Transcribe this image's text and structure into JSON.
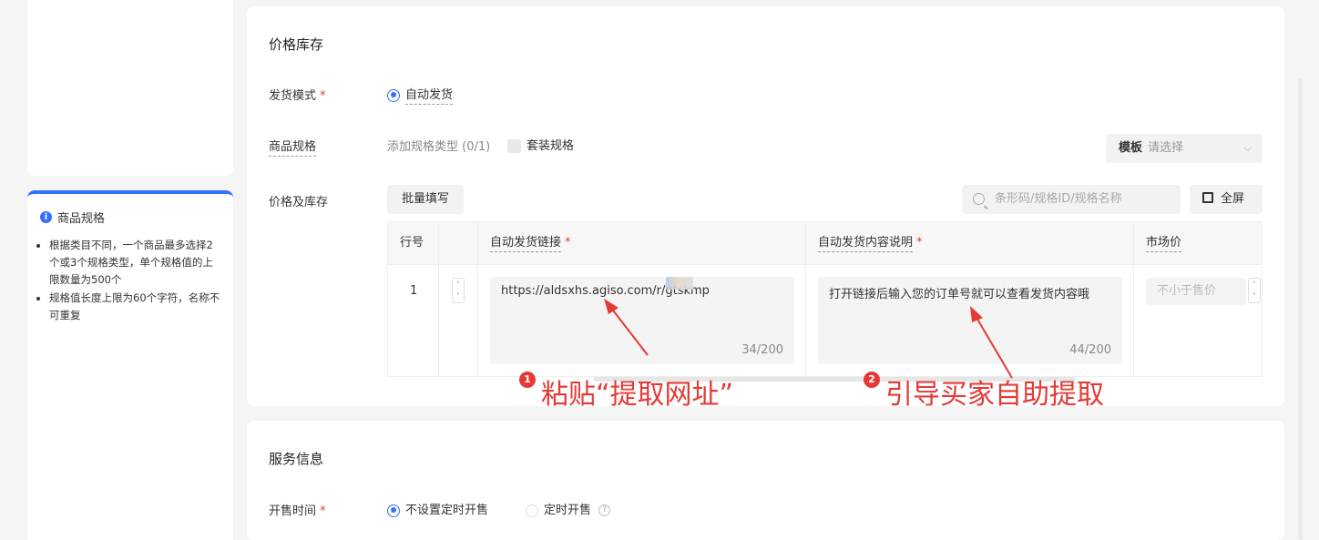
{
  "left_panel": {
    "tip": {
      "title": "商品规格",
      "items": [
        "根据类目不同，一个商品最多选择2个或3个规格类型，单个规格值的上限数量为500个",
        "规格值长度上限为60个字符，名称不可重复"
      ]
    }
  },
  "price_section": {
    "title": "价格库存",
    "shipping": {
      "label": "发货模式",
      "required": "*",
      "option": "自动发货"
    },
    "spec": {
      "label": "商品规格",
      "add_text": "添加规格类型 (0/1)",
      "bundle_label": "套装规格",
      "template_label": "模板",
      "template_placeholder": "请选择"
    },
    "stock": {
      "label": "价格及库存",
      "batch_button": "批量填写",
      "search_placeholder": "条形码/规格ID/规格名称",
      "fullscreen_button": "全屏"
    },
    "table": {
      "headers": [
        "行号",
        "自动发货链接",
        "自动发货内容说明",
        "市场价"
      ],
      "required": "*",
      "rows": [
        {
          "index": "1",
          "link": "https://aldsxhs.agiso.com/r/gtskmp",
          "link_count": "34/200",
          "desc": "打开链接后输入您的订单号就可以查看发货内容哦",
          "desc_count": "44/200",
          "market_price_placeholder": "不小于售价"
        }
      ]
    }
  },
  "annotations": [
    {
      "number": "1",
      "text": "粘贴“提取网址”"
    },
    {
      "number": "2",
      "text": "引导买家自助提取"
    }
  ],
  "service_section": {
    "title": "服务信息",
    "sale_time": {
      "label": "开售时间",
      "required": "*",
      "option_on": "不设置定时开售",
      "option_off": "定时开售"
    }
  },
  "colors": {
    "primary": "#3370ff",
    "annotation": "#e53935"
  }
}
